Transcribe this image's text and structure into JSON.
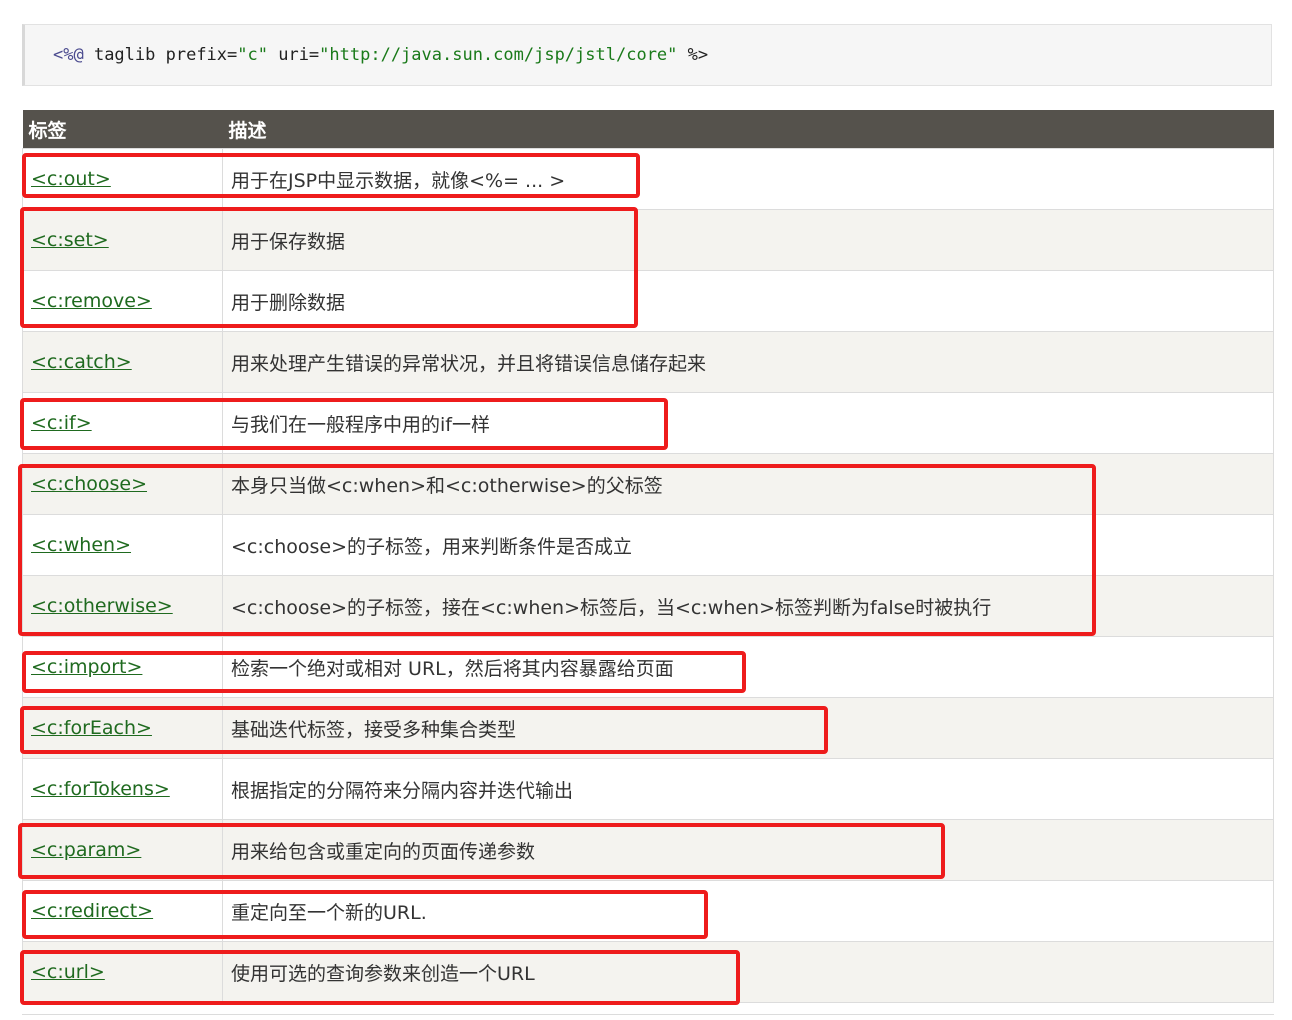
{
  "code": {
    "open": "<%@",
    "directive": " taglib ",
    "attr1": "prefix=",
    "val1": "\"c\"",
    "attr2": " uri=",
    "val2": "\"http://java.sun.com/jsp/jstl/core\"",
    "close": " %>"
  },
  "table": {
    "header": {
      "tag": "标签",
      "desc": "描述"
    },
    "rows": [
      {
        "tag": "<c:out>",
        "desc": "用于在JSP中显示数据，就像<%= ... >"
      },
      {
        "tag": "<c:set>",
        "desc": "用于保存数据"
      },
      {
        "tag": "<c:remove>",
        "desc": "用于删除数据"
      },
      {
        "tag": "<c:catch>",
        "desc": "用来处理产生错误的异常状况，并且将错误信息储存起来"
      },
      {
        "tag": "<c:if>",
        "desc": "与我们在一般程序中用的if一样"
      },
      {
        "tag": "<c:choose>",
        "desc": "本身只当做<c:when>和<c:otherwise>的父标签"
      },
      {
        "tag": "<c:when>",
        "desc": "<c:choose>的子标签，用来判断条件是否成立"
      },
      {
        "tag": "<c:otherwise>",
        "desc": "<c:choose>的子标签，接在<c:when>标签后，当<c:when>标签判断为false时被执行"
      },
      {
        "tag": "<c:import>",
        "desc": "检索一个绝对或相对 URL，然后将其内容暴露给页面"
      },
      {
        "tag": "<c:forEach>",
        "desc": "基础迭代标签，接受多种集合类型"
      },
      {
        "tag": "<c:forTokens>",
        "desc": "根据指定的分隔符来分隔内容并迭代输出"
      },
      {
        "tag": "<c:param>",
        "desc": "用来给包含或重定向的页面传递参数"
      },
      {
        "tag": "<c:redirect>",
        "desc": "重定向至一个新的URL."
      },
      {
        "tag": "<c:url>",
        "desc": "使用可选的查询参数来创造一个URL"
      }
    ]
  },
  "highlight_color": "#ee1c1c"
}
